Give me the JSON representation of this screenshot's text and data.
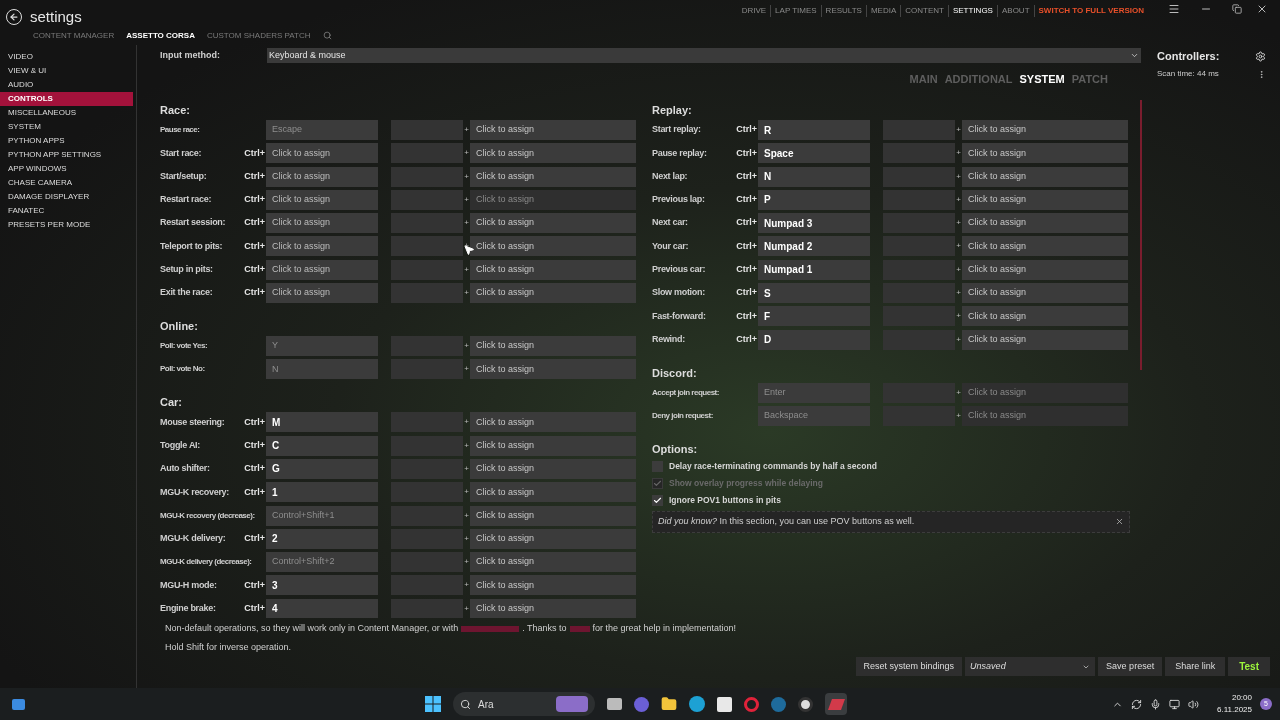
{
  "header": {
    "title": "settings",
    "subtabs": [
      {
        "label": "CONTENT MANAGER",
        "selected": false
      },
      {
        "label": "ASSETTO CORSA",
        "selected": true
      },
      {
        "label": "CUSTOM SHADERS PATCH",
        "selected": false
      }
    ],
    "nav": [
      {
        "label": "DRIVE",
        "kind": "normal",
        "selected": false
      },
      {
        "label": "LAP TIMES",
        "kind": "normal",
        "selected": false
      },
      {
        "label": "RESULTS",
        "kind": "normal",
        "selected": false
      },
      {
        "label": "MEDIA",
        "kind": "normal",
        "selected": false
      },
      {
        "label": "CONTENT",
        "kind": "normal",
        "selected": false
      },
      {
        "label": "SETTINGS",
        "kind": "normal",
        "selected": true
      },
      {
        "label": "ABOUT",
        "kind": "normal",
        "selected": false
      },
      {
        "label": "SWITCH TO FULL VERSION",
        "kind": "accent",
        "selected": false
      }
    ]
  },
  "sidebar": {
    "items": [
      {
        "label": "VIDEO",
        "selected": false
      },
      {
        "label": "VIEW & UI",
        "selected": false
      },
      {
        "label": "AUDIO",
        "selected": false
      },
      {
        "label": "CONTROLS",
        "selected": true
      },
      {
        "label": "MISCELLANEOUS",
        "selected": false
      },
      {
        "label": "SYSTEM",
        "selected": false
      },
      {
        "label": "PYTHON APPS",
        "selected": false
      },
      {
        "label": "PYTHON APP SETTINGS",
        "selected": false
      },
      {
        "label": "APP WINDOWS",
        "selected": false
      },
      {
        "label": "CHASE CAMERA",
        "selected": false
      },
      {
        "label": "DAMAGE DISPLAYER",
        "selected": false
      },
      {
        "label": "FANATEC",
        "selected": false
      },
      {
        "label": "PRESETS PER MODE",
        "selected": false
      }
    ]
  },
  "input_method": {
    "label": "Input method:",
    "value": "Keyboard & mouse"
  },
  "section_tabs": [
    {
      "label": "MAIN",
      "selected": false
    },
    {
      "label": "ADDITIONAL",
      "selected": false
    },
    {
      "label": "SYSTEM",
      "selected": true
    },
    {
      "label": "PATCH",
      "selected": false
    }
  ],
  "left_sections": [
    {
      "title": "Race:",
      "rows": [
        {
          "label": "Pause race:",
          "placeholder": "Escape",
          "joiner": "+",
          "assign": "Click to assign",
          "assign_disabled": false
        },
        {
          "label": "Start race:",
          "modifier": "Ctrl+",
          "placeholder": "Click to assign",
          "joiner": "+",
          "assign": "Click to assign",
          "assign_disabled": false
        },
        {
          "label": "Start/setup:",
          "modifier": "Ctrl+",
          "placeholder": "Click to assign",
          "joiner": "+",
          "assign": "Click to assign",
          "assign_disabled": false
        },
        {
          "label": "Restart race:",
          "modifier": "Ctrl+",
          "placeholder": "Click to assign",
          "joiner": "+",
          "assign": "Click to assign",
          "assign_disabled": true
        },
        {
          "label": "Restart session:",
          "modifier": "Ctrl+",
          "placeholder": "Click to assign",
          "joiner": "+",
          "assign": "Click to assign",
          "assign_disabled": false
        },
        {
          "label": "Teleport to pits:",
          "modifier": "Ctrl+",
          "placeholder": "Click to assign",
          "joiner": "+",
          "assign": "Click to assign",
          "assign_disabled": false
        },
        {
          "label": "Setup in pits:",
          "modifier": "Ctrl+",
          "placeholder": "Click to assign",
          "joiner": "+",
          "assign": "Click to assign",
          "assign_disabled": false
        },
        {
          "label": "Exit the race:",
          "modifier": "Ctrl+",
          "placeholder": "Click to assign",
          "joiner": "+",
          "assign": "Click to assign",
          "assign_disabled": false
        }
      ]
    },
    {
      "title": "Online:",
      "rows": [
        {
          "label": "Poll: vote Yes:",
          "placeholder": "Y",
          "joiner": "+",
          "assign": "Click to assign",
          "assign_disabled": false
        },
        {
          "label": "Poll: vote No:",
          "placeholder": "N",
          "joiner": "+",
          "assign": "Click to assign",
          "assign_disabled": false
        }
      ]
    },
    {
      "title": "Car:",
      "rows": [
        {
          "label": "Mouse steering:",
          "modifier": "Ctrl+",
          "value": "M",
          "joiner": "+",
          "assign": "Click to assign",
          "assign_disabled": false
        },
        {
          "label": "Toggle AI:",
          "modifier": "Ctrl+",
          "value": "C",
          "joiner": "+",
          "assign": "Click to assign",
          "assign_disabled": false
        },
        {
          "label": "Auto shifter:",
          "modifier": "Ctrl+",
          "value": "G",
          "joiner": "+",
          "assign": "Click to assign",
          "assign_disabled": false
        },
        {
          "label": "MGU-K recovery:",
          "modifier": "Ctrl+",
          "value": "1",
          "joiner": "+",
          "assign": "Click to assign",
          "assign_disabled": false
        },
        {
          "label": "MGU-K recovery (decrease):",
          "placeholder": "Control+Shift+1",
          "joiner": "+",
          "assign": "Click to assign",
          "assign_disabled": false
        },
        {
          "label": "MGU-K delivery:",
          "modifier": "Ctrl+",
          "value": "2",
          "joiner": "+",
          "assign": "Click to assign",
          "assign_disabled": false
        },
        {
          "label": "MGU-K delivery (decrease):",
          "placeholder": "Control+Shift+2",
          "joiner": "+",
          "assign": "Click to assign",
          "assign_disabled": false
        },
        {
          "label": "MGU-H mode:",
          "modifier": "Ctrl+",
          "value": "3",
          "joiner": "+",
          "assign": "Click to assign",
          "assign_disabled": false
        },
        {
          "label": "Engine brake:",
          "modifier": "Ctrl+",
          "value": "4",
          "joiner": "+",
          "assign": "Click to assign",
          "assign_disabled": false
        }
      ]
    }
  ],
  "right_sections": [
    {
      "title": "Replay:",
      "rows": [
        {
          "label": "Start replay:",
          "modifier": "Ctrl+",
          "value": "R",
          "joiner": "+",
          "assign": "Click to assign",
          "assign_disabled": false
        },
        {
          "label": "Pause replay:",
          "modifier": "Ctrl+",
          "value": "Space",
          "joiner": "+",
          "assign": "Click to assign",
          "assign_disabled": false
        },
        {
          "label": "Next lap:",
          "modifier": "Ctrl+",
          "value": "N",
          "joiner": "+",
          "assign": "Click to assign",
          "assign_disabled": false
        },
        {
          "label": "Previous lap:",
          "modifier": "Ctrl+",
          "value": "P",
          "joiner": "+",
          "assign": "Click to assign",
          "assign_disabled": false
        },
        {
          "label": "Next car:",
          "modifier": "Ctrl+",
          "value": "Numpad 3",
          "joiner": "+",
          "assign": "Click to assign",
          "assign_disabled": false
        },
        {
          "label": "Your car:",
          "modifier": "Ctrl+",
          "value": "Numpad 2",
          "joiner": "+",
          "assign": "Click to assign",
          "assign_disabled": false
        },
        {
          "label": "Previous car:",
          "modifier": "Ctrl+",
          "value": "Numpad 1",
          "joiner": "+",
          "assign": "Click to assign",
          "assign_disabled": false
        },
        {
          "label": "Slow motion:",
          "modifier": "Ctrl+",
          "value": "S",
          "joiner": "+",
          "assign": "Click to assign",
          "assign_disabled": false
        },
        {
          "label": "Fast-forward:",
          "modifier": "Ctrl+",
          "value": "F",
          "joiner": "+",
          "assign": "Click to assign",
          "assign_disabled": false
        },
        {
          "label": "Rewind:",
          "modifier": "Ctrl+",
          "value": "D",
          "joiner": "+",
          "assign": "Click to assign",
          "assign_disabled": false
        }
      ]
    },
    {
      "title": "Discord:",
      "rows": [
        {
          "label": "Accept join request:",
          "placeholder": "Enter",
          "joiner": "+",
          "assign": "Click to assign",
          "assign_disabled": true
        },
        {
          "label": "Deny join request:",
          "placeholder": "Backspace",
          "joiner": "+",
          "assign": "Click to assign",
          "assign_disabled": true
        }
      ]
    }
  ],
  "options": {
    "title": "Options:",
    "items": [
      {
        "label": "Delay race-terminating commands by half a second",
        "checked": false,
        "disabled": false
      },
      {
        "label": "Show overlay progress while delaying",
        "checked": true,
        "disabled": true
      },
      {
        "label": "Ignore POV1 buttons in pits",
        "checked": true,
        "disabled": false
      }
    ],
    "tip": "*Did you know?* In this section, you can use POV buttons as well."
  },
  "notes": {
    "line_1_start": "Non-default operations, so they will work only in Content Manager, or with",
    "line_1_middle": ". Thanks to",
    "line_1_end": "for the great help in implementation!",
    "line_2": "Hold Shift for inverse operation."
  },
  "bottom_bar": {
    "reset": "Reset system bindings",
    "preset": "Unsaved",
    "save": "Save preset",
    "share": "Share link",
    "test": "Test"
  },
  "controllers": {
    "title": "Controllers:",
    "scan_time": "Scan time: 44 ms"
  },
  "taskbar": {
    "search": "Ara",
    "time": "20:00",
    "date": "6.11.2025",
    "badge": "5"
  }
}
